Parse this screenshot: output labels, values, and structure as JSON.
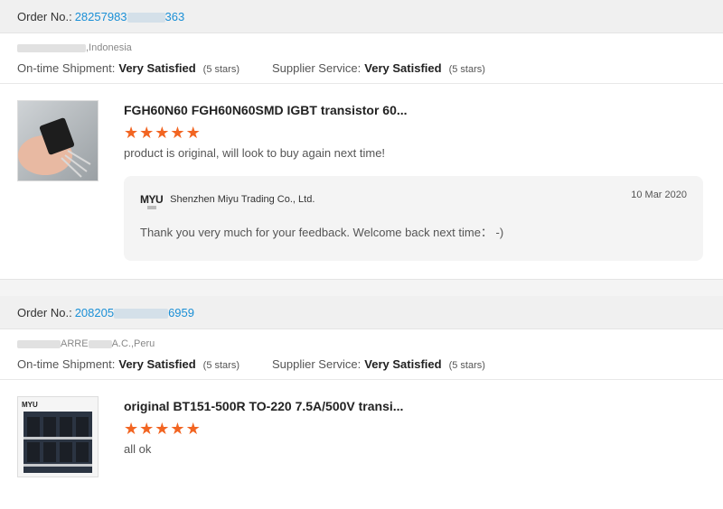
{
  "orders": [
    {
      "order_label": "Order No.:",
      "order_number": "28257983…363",
      "buyer": "Indonesia",
      "shipment_label": "On-time Shipment:",
      "shipment_value": "Very Satisfied",
      "shipment_stars": "(5 stars)",
      "service_label": "Supplier Service:",
      "service_value": "Very Satisfied",
      "service_stars": "(5 stars)",
      "product_title": "FGH60N60 FGH60N60SMD IGBT transistor 60...",
      "rating": 5,
      "review": "product is original, will look to buy again next time!",
      "reply": {
        "seller_logo": "MYU",
        "seller_name": "Shenzhen Miyu Trading Co., Ltd.",
        "date": "10 Mar 2020",
        "text": "Thank you very much for your feedback. Welcome back next time： -)"
      }
    },
    {
      "order_label": "Order No.:",
      "order_number": "208205…6959",
      "buyer": "ARRE… A.C.,Peru",
      "shipment_label": "On-time Shipment:",
      "shipment_value": "Very Satisfied",
      "shipment_stars": "(5 stars)",
      "service_label": "Supplier Service:",
      "service_value": "Very Satisfied",
      "service_stars": "(5 stars)",
      "product_title": "original BT151-500R TO-220 7.5A/500V transi...",
      "rating": 5,
      "review": "all ok"
    }
  ],
  "colors": {
    "star": "#f26522",
    "link": "#1a8fd6",
    "header_bg": "#f0f0f0"
  },
  "icons": {
    "star": "star-icon",
    "logo": "myu-logo"
  }
}
